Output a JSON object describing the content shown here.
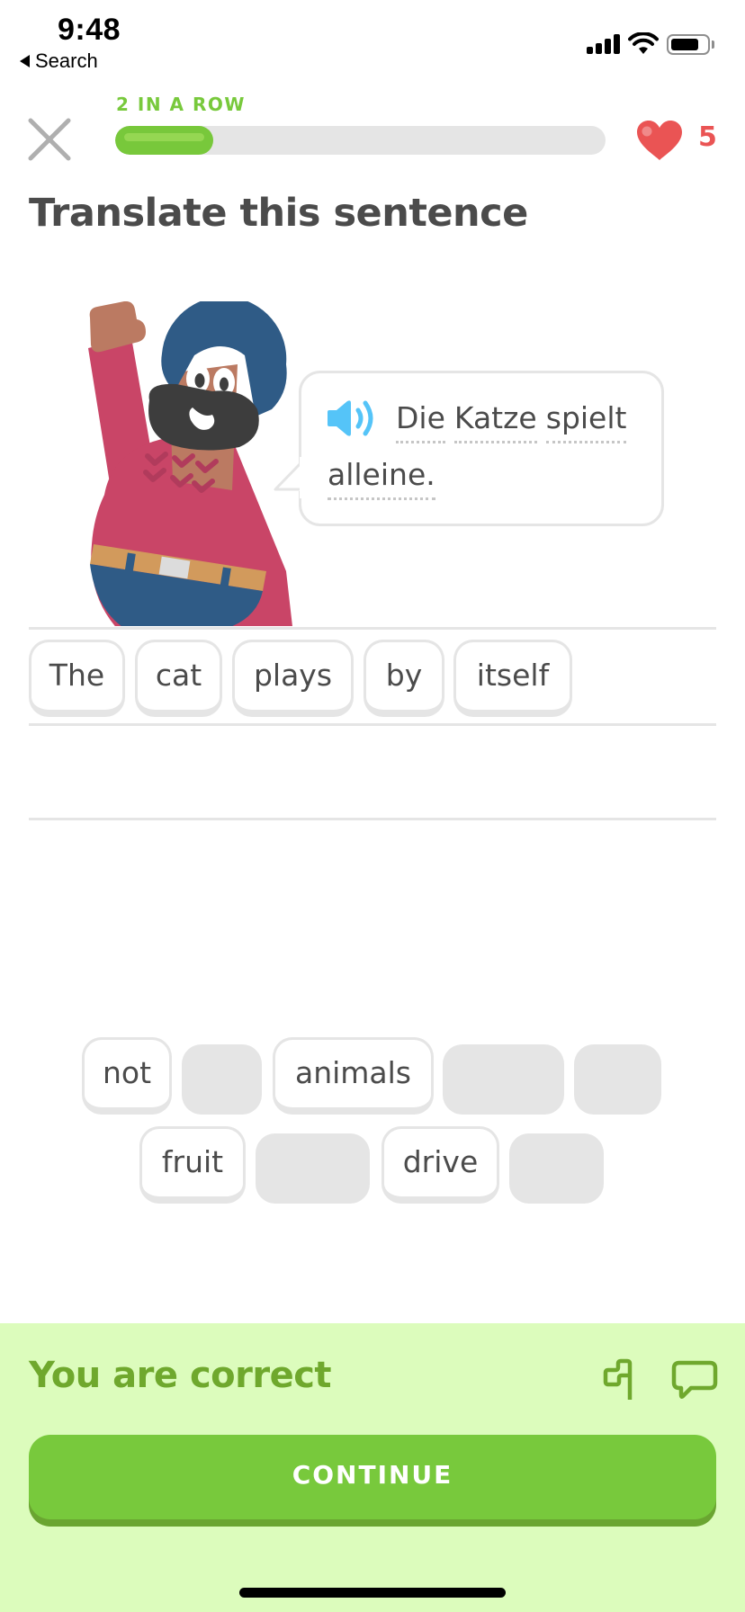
{
  "status_bar": {
    "time": "9:48",
    "back_label": "Search",
    "battery_level": 0.8
  },
  "header": {
    "streak_label": "2 IN A ROW",
    "progress": 0.2,
    "hearts": "5",
    "colors": {
      "accent": "#78c93c",
      "heart": "#ea5454",
      "track": "#e5e5e5"
    }
  },
  "lesson": {
    "title": "Translate this sentence",
    "prompt_line1": [
      "Die",
      "Katze",
      "spielt"
    ],
    "prompt_line2": [
      "alleine."
    ],
    "prompt_icon": "speaker-icon"
  },
  "answer": {
    "selected_words": [
      "The",
      "cat",
      "plays",
      "by",
      "itself"
    ]
  },
  "word_bank": {
    "row1": [
      {
        "label": "not",
        "used": false
      },
      {
        "label": "",
        "used": true
      },
      {
        "label": "animals",
        "used": false
      },
      {
        "label": "",
        "used": true
      },
      {
        "label": "",
        "used": true
      }
    ],
    "row2": [
      {
        "label": "fruit",
        "used": false
      },
      {
        "label": "",
        "used": true
      },
      {
        "label": "drive",
        "used": false
      },
      {
        "label": "",
        "used": true
      }
    ]
  },
  "feedback": {
    "message": "You are correct",
    "continue_label": "CONTINUE",
    "icons": [
      "flag-icon",
      "chat-icon"
    ],
    "colors": {
      "background": "#dcfcbc",
      "text": "#6fa82d",
      "button": "#78c93c"
    }
  }
}
